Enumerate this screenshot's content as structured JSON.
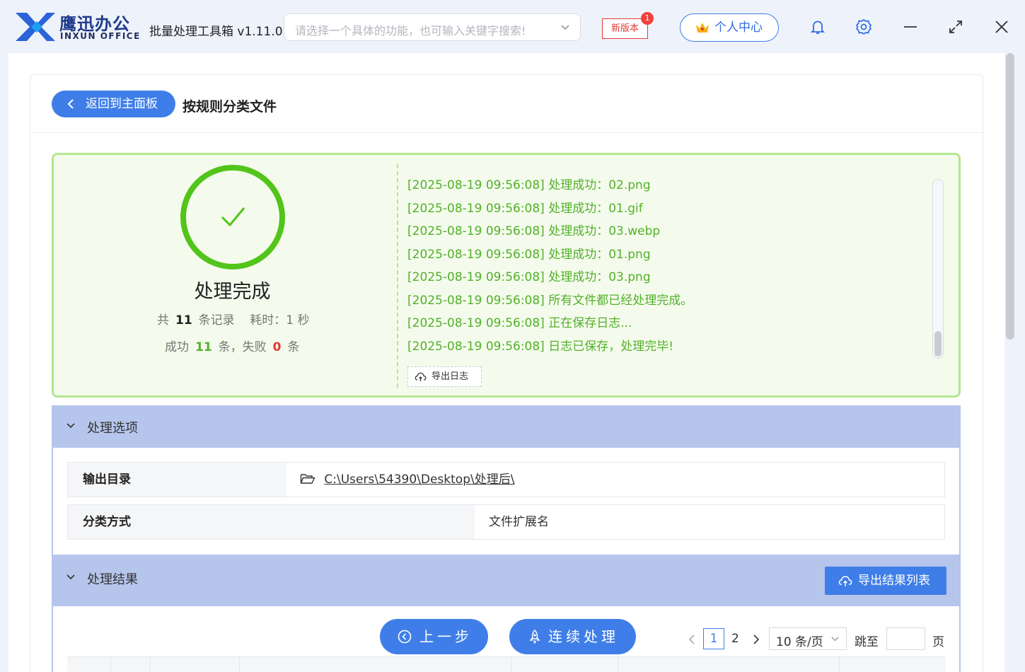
{
  "app": {
    "brand_cn": "鹰迅办公",
    "brand_en": "INXUN OFFICE",
    "name": "批量处理工具箱 v1.11.0",
    "search_placeholder": "请选择一个具体的功能，也可输入关键字搜索!",
    "new_version_label": "新版本",
    "new_version_count": "1",
    "personal_center": "个人中心",
    "accent_color": "#3f7ee8"
  },
  "page": {
    "back_label": "返回到主面板",
    "title": "按规则分类文件"
  },
  "result": {
    "status": "处理完成",
    "total_prefix": "共",
    "total_count": "11",
    "total_suffix": "条记录",
    "time_label": "耗时：1 秒",
    "success_prefix": "成功",
    "success_count": "11",
    "success_suffix": "条，失败",
    "fail_count": "0",
    "fail_suffix": "条",
    "logs": [
      "[2025-08-19 09:56:08] 处理成功：02.png",
      "[2025-08-19 09:56:08] 处理成功：01.gif",
      "[2025-08-19 09:56:08] 处理成功：03.webp",
      "[2025-08-19 09:56:08] 处理成功：01.png",
      "[2025-08-19 09:56:08] 处理成功：03.png",
      "[2025-08-19 09:56:08] 所有文件都已经处理完成。",
      "[2025-08-19 09:56:08] 正在保存日志...",
      "[2025-08-19 09:56:08] 日志已保存，处理完毕!"
    ],
    "export_log_label": "导出日志",
    "success_color": "#52b02a"
  },
  "options": {
    "section_title": "处理选项",
    "output_dir_label": "输出目录",
    "output_dir_value": "C:\\Users\\54390\\Desktop\\处理后\\",
    "classify_label": "分类方式",
    "classify_value": "文件扩展名"
  },
  "results_section": {
    "title": "处理结果",
    "export_list_label": "导出结果列表"
  },
  "actions": {
    "prev_label": "上一步",
    "continue_label": "连续处理"
  },
  "pagination": {
    "prev": "<",
    "pages": [
      "1",
      "2"
    ],
    "current": "1",
    "next": ">",
    "page_size": "10 条/页",
    "goto_label": "跳至",
    "goto_value": "",
    "page_suffix": "页"
  },
  "icons": [
    "logo-x-icon",
    "chevron-down-icon",
    "crown-icon",
    "bell-icon",
    "gear-icon",
    "minimize-icon",
    "maximize-icon",
    "close-icon",
    "back-chevron-icon",
    "check-circle-icon",
    "cloud-upload-icon",
    "folder-open-icon",
    "clock-back-icon",
    "rocket-icon"
  ]
}
